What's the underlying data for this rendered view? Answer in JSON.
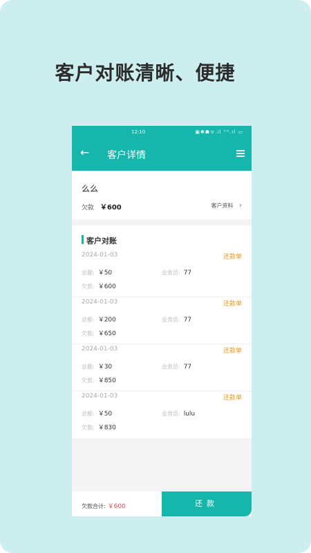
{
  "headline": "客户对账清晰、便捷",
  "status_bar": {
    "time": "12:10",
    "icons": "▣✱☗ᯤ.ıl ⁵ᴳ.ıl ▭"
  },
  "app_bar": {
    "back_icon": "←",
    "title": "客户详情",
    "menu_icon": "menu-icon"
  },
  "customer": {
    "name": "么么",
    "debt_label": "欠款",
    "debt_amount": "￥600",
    "profile_link": "客户资料",
    "profile_chevron": "›"
  },
  "ledger": {
    "title": "客户对账",
    "total_label": "总额:",
    "staff_label": "业务员:",
    "debt_label": "欠款:",
    "entries": [
      {
        "date": "2024-01-03",
        "type": "还款单",
        "total": "￥50",
        "staff": "77",
        "debt": "￥600"
      },
      {
        "date": "2024-01-03",
        "type": "还款单",
        "total": "￥200",
        "staff": "77",
        "debt": "￥650"
      },
      {
        "date": "2024-01-03",
        "type": "还款单",
        "total": "￥30",
        "staff": "77",
        "debt": "￥850"
      },
      {
        "date": "2024-01-03",
        "type": "还款单",
        "total": "￥50",
        "staff": "lulu",
        "debt": "￥830"
      }
    ]
  },
  "bottom_bar": {
    "sum_label": "欠款合计:",
    "sum_value": "￥600",
    "repay_button": "还款"
  },
  "colors": {
    "accent": "#17b6ac",
    "background": "#cdeeee",
    "warning": "#e89a1c",
    "debt_red": "#e04a4a"
  }
}
